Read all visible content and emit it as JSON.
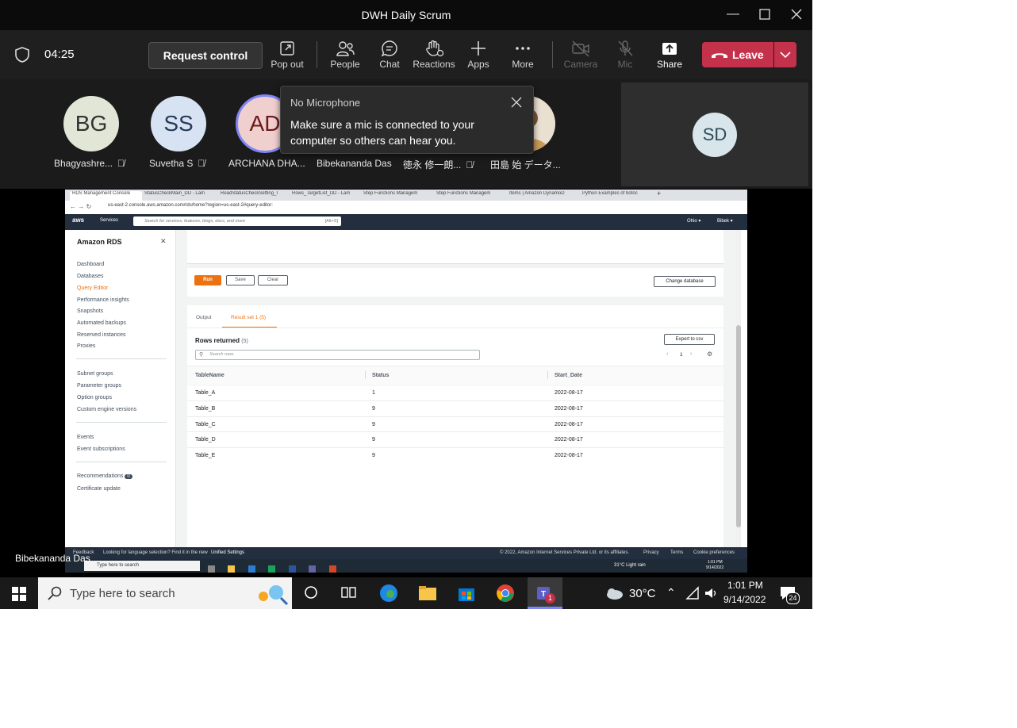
{
  "window": {
    "title": "DWH Daily Scrum"
  },
  "toolbar": {
    "timer": "04:25",
    "request_control": "Request control",
    "items": [
      {
        "label": "Pop out"
      },
      {
        "label": "People"
      },
      {
        "label": "Chat"
      },
      {
        "label": "Reactions"
      },
      {
        "label": "Apps"
      },
      {
        "label": "More"
      },
      {
        "label": "Camera"
      },
      {
        "label": "Mic"
      },
      {
        "label": "Share"
      }
    ],
    "leave": "Leave"
  },
  "participants": [
    {
      "initials": "BG",
      "name": "Bhagyashre...",
      "muted": true,
      "color": "#e2e6d6"
    },
    {
      "initials": "SS",
      "name": "Suvetha S",
      "muted": true,
      "color": "#d7e3f2"
    },
    {
      "initials": "AD",
      "name": "ARCHANA DHA...",
      "muted": false,
      "color": "#f0cfcf"
    },
    {
      "initials": "",
      "name": "Bibekananda Das",
      "muted": false,
      "color": "#3a3a3a"
    },
    {
      "initials": "",
      "name": "徳永 修一朗...",
      "muted": true,
      "color": "#3a3a3a"
    },
    {
      "initials": "",
      "name": "田島 始 データ...",
      "muted": false,
      "color": "#b88a55"
    }
  ],
  "self_tile": {
    "initials": "SD"
  },
  "tooltip": {
    "title": "No Microphone",
    "body": "Make sure a mic is connected to your computer so others can hear you."
  },
  "presenter": "Bibekananda Das",
  "browser": {
    "tabs": [
      "RDS Management Console",
      "StatusCheckMain_DD - Lam",
      "ReadStatusCheckSetting_I",
      "Rows_TargetList_DD - Lam",
      "Step Functions Managem",
      "Step Functions Managem",
      "Items | Amazon DynamoD",
      "Python Examples of botoc"
    ],
    "url": "us-east-2.console.aws.amazon.com/rds/home?region=us-east-2#query-editor:"
  },
  "aws": {
    "logo": "aws",
    "services": "Services",
    "search_placeholder": "Search for services, features, blogs, docs, and more",
    "shortcut": "[Alt+S]",
    "region": "Ohio ▾",
    "user": "Bibek ▾"
  },
  "rds_nav": {
    "title": "Amazon RDS",
    "group1": [
      "Dashboard",
      "Databases",
      "Query Editor",
      "Performance insights",
      "Snapshots",
      "Automated backups",
      "Reserved instances",
      "Proxies"
    ],
    "group2": [
      "Subnet groups",
      "Parameter groups",
      "Option groups",
      "Custom engine versions"
    ],
    "group3": [
      "Events",
      "Event subscriptions"
    ],
    "group4": [
      "Recommendations",
      "Certificate update"
    ],
    "recommendations_count": "0"
  },
  "editor": {
    "run": "Run",
    "save": "Save",
    "clear": "Clear",
    "change_db": "Change database"
  },
  "results": {
    "tab_output": "Output",
    "tab_result": "Result set 1 (5)",
    "rows_returned": "Rows returned",
    "rows_count": "(5)",
    "export": "Export to csv",
    "search_placeholder": "Search rows",
    "page": "1",
    "columns": [
      "TableName",
      "Status",
      "Start_Date"
    ],
    "rows": [
      [
        "Table_A",
        "1",
        "2022-08-17"
      ],
      [
        "Table_B",
        "9",
        "2022-08-17"
      ],
      [
        "Table_C",
        "9",
        "2022-08-17"
      ],
      [
        "Table_D",
        "9",
        "2022-08-17"
      ],
      [
        "Table_E",
        "9",
        "2022-08-17"
      ]
    ]
  },
  "aws_footer": {
    "feedback": "Feedback",
    "lang": "Looking for language selection? Find it in the new",
    "unified": "Unified Settings",
    "copyright": "© 2022, Amazon Internet Services Private Ltd. or its affiliates.",
    "privacy": "Privacy",
    "terms": "Terms",
    "cookies": "Cookie preferences"
  },
  "inner_taskbar": {
    "search": "Type here to search",
    "weather": "31°C  Light rain",
    "time": "1:01 PM",
    "date": "9/14/2022"
  },
  "taskbar": {
    "search": "Type here to search",
    "temp": "30°C",
    "time": "1:01 PM",
    "date": "9/14/2022",
    "notifications": "24",
    "teams_badge": "1"
  }
}
